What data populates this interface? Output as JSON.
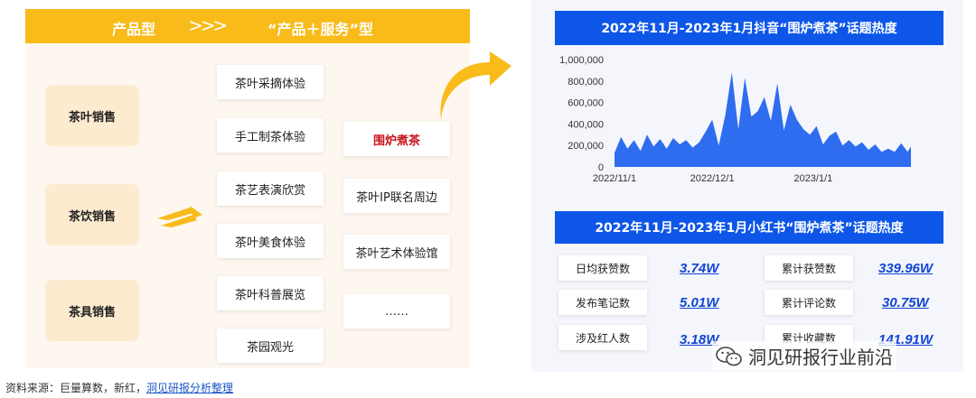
{
  "left": {
    "banner_left": "产品型",
    "banner_chevrons": ">>>",
    "banner_right": "“产品＋服务”型",
    "product_types": [
      "茶叶销售",
      "茶饮销售",
      "茶具销售"
    ],
    "experience_services": [
      "茶叶采摘体验",
      "手工制茶体验",
      "茶艺表演欣赏",
      "茶叶美食体验",
      "茶叶科普展览",
      "茶园观光"
    ],
    "extended_services": [
      "围炉煮茶",
      "茶叶IP联名周边",
      "茶叶艺术体验馆",
      "……"
    ],
    "highlight_color": "#c8161d",
    "accent_color": "#f8bb1a"
  },
  "right": {
    "douyin_title": "2022年11月-2023年1月抖音“围炉煮茶”话题热度",
    "xhs_title": "2022年11月-2023年1月小红书“围炉煮茶”话题热度",
    "xhs_stats": [
      {
        "label": "日均获赞数",
        "value": "3.74W"
      },
      {
        "label": "累计获赞数",
        "value": "339.96W"
      },
      {
        "label": "发布笔记数",
        "value": "5.01W"
      },
      {
        "label": "累计评论数",
        "value": "30.75W"
      },
      {
        "label": "涉及红人数",
        "value": "3.18W"
      },
      {
        "label": "累计收藏数",
        "value": "141.91W"
      }
    ],
    "header_color": "#0d56e8"
  },
  "chart_data": {
    "type": "area",
    "title": "2022年11月-2023年1月抖音“围炉煮茶”话题热度",
    "xlabel": "",
    "ylabel": "",
    "y_ticks": [
      "0",
      "200,000",
      "400,000",
      "600,000",
      "800,000",
      "1,000,000"
    ],
    "ylim": [
      0,
      1000000
    ],
    "x_ticks": [
      "2022/11/1",
      "2022/12/1",
      "2023/1/1"
    ],
    "x_range": [
      "2022-11-01",
      "2023-01-31"
    ],
    "grid": false,
    "series_color": "#2f6df0",
    "x": [
      "2022-11-01",
      "2022-11-03",
      "2022-11-05",
      "2022-11-07",
      "2022-11-09",
      "2022-11-11",
      "2022-11-13",
      "2022-11-15",
      "2022-11-17",
      "2022-11-19",
      "2022-11-21",
      "2022-11-23",
      "2022-11-25",
      "2022-11-27",
      "2022-11-29",
      "2022-12-01",
      "2022-12-03",
      "2022-12-05",
      "2022-12-07",
      "2022-12-09",
      "2022-12-11",
      "2022-12-13",
      "2022-12-15",
      "2022-12-17",
      "2022-12-19",
      "2022-12-21",
      "2022-12-23",
      "2022-12-25",
      "2022-12-27",
      "2022-12-29",
      "2022-12-31",
      "2023-01-02",
      "2023-01-04",
      "2023-01-06",
      "2023-01-08",
      "2023-01-10",
      "2023-01-12",
      "2023-01-14",
      "2023-01-16",
      "2023-01-18",
      "2023-01-20",
      "2023-01-22",
      "2023-01-24",
      "2023-01-26",
      "2023-01-28",
      "2023-01-30",
      "2023-01-31"
    ],
    "values": [
      130000,
      280000,
      170000,
      250000,
      150000,
      300000,
      190000,
      260000,
      170000,
      270000,
      210000,
      250000,
      180000,
      230000,
      330000,
      440000,
      200000,
      480000,
      880000,
      350000,
      830000,
      470000,
      520000,
      650000,
      430000,
      780000,
      340000,
      580000,
      440000,
      350000,
      300000,
      380000,
      210000,
      290000,
      330000,
      200000,
      250000,
      190000,
      230000,
      160000,
      210000,
      140000,
      170000,
      140000,
      220000,
      140000,
      190000
    ]
  },
  "footer": {
    "watermark": "洞见研报行业前沿",
    "source_prefix": "资料来源：巨量算数，新红，",
    "source_link": "洞见研报分析整理"
  }
}
